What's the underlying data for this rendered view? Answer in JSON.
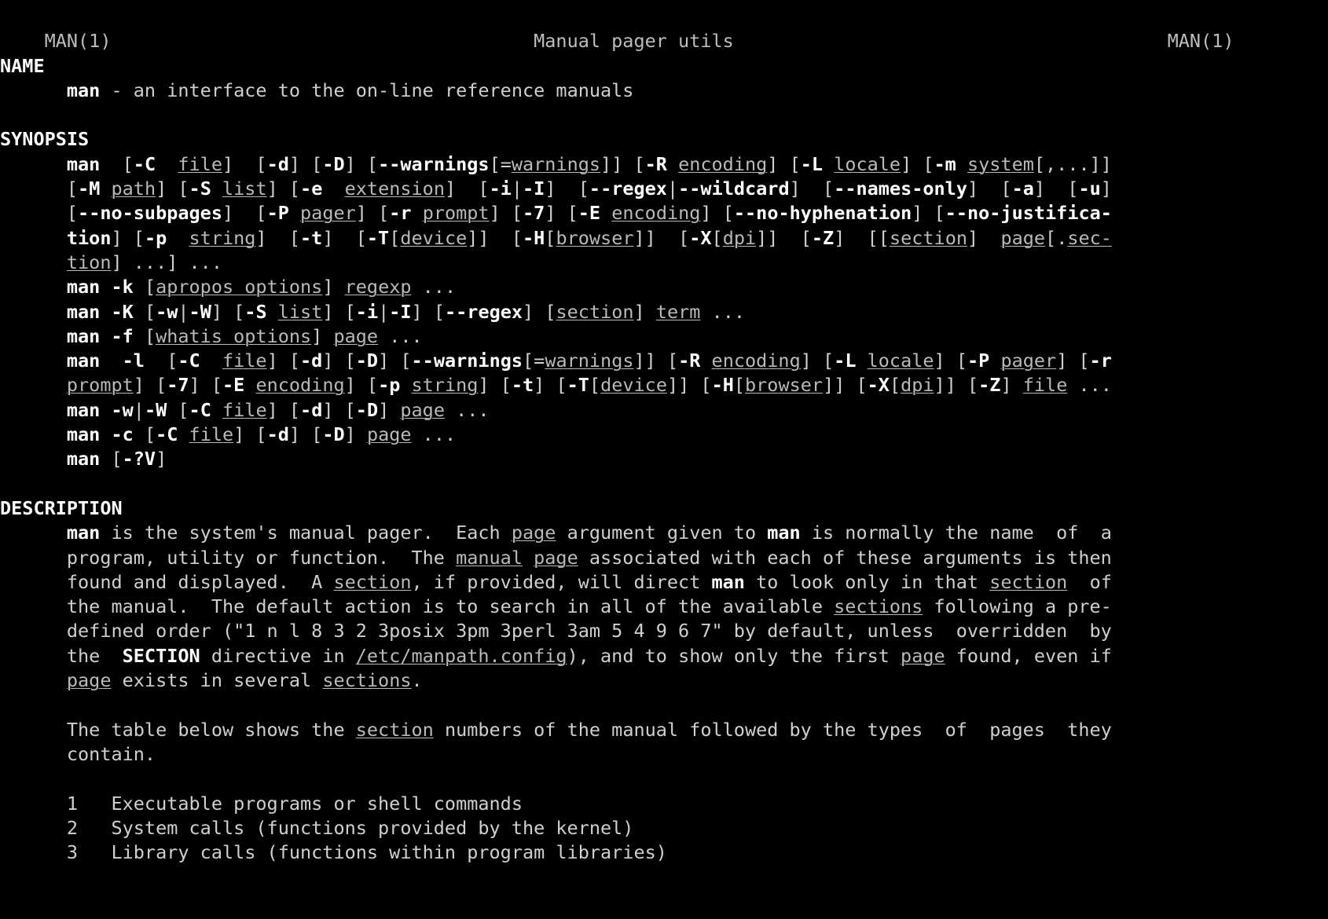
{
  "terminal": {
    "background": "#000000",
    "foreground": "#cfcfcf",
    "bold_color": "#ffffff",
    "italic_color": "#b9b9b9",
    "cols": 107,
    "rows": 37
  },
  "header": {
    "left": "MAN(1)",
    "center": "Manual pager utils",
    "right": "MAN(1)"
  },
  "sections": {
    "name": "NAME",
    "synopsis": "SYNOPSIS",
    "description": "DESCRIPTION"
  },
  "name_body": {
    "command": "man",
    "text": " - an interface to the on-line reference manuals"
  },
  "synopsis_lines": [
    [
      {
        "t": "      ",
        "s": "n"
      },
      {
        "t": "man",
        "s": "b"
      },
      {
        "t": "  [",
        "s": "n"
      },
      {
        "t": "-C",
        "s": "b"
      },
      {
        "t": "  ",
        "s": "n"
      },
      {
        "t": "file",
        "s": "i"
      },
      {
        "t": "]  [",
        "s": "n"
      },
      {
        "t": "-d",
        "s": "b"
      },
      {
        "t": "] [",
        "s": "n"
      },
      {
        "t": "-D",
        "s": "b"
      },
      {
        "t": "] [",
        "s": "n"
      },
      {
        "t": "--warnings",
        "s": "b"
      },
      {
        "t": "[=",
        "s": "n"
      },
      {
        "t": "warnings",
        "s": "i"
      },
      {
        "t": "]] [",
        "s": "n"
      },
      {
        "t": "-R",
        "s": "b"
      },
      {
        "t": " ",
        "s": "n"
      },
      {
        "t": "encoding",
        "s": "i"
      },
      {
        "t": "] [",
        "s": "n"
      },
      {
        "t": "-L",
        "s": "b"
      },
      {
        "t": " ",
        "s": "n"
      },
      {
        "t": "locale",
        "s": "i"
      },
      {
        "t": "] [",
        "s": "n"
      },
      {
        "t": "-m",
        "s": "b"
      },
      {
        "t": " ",
        "s": "n"
      },
      {
        "t": "system",
        "s": "i"
      },
      {
        "t": "[,...]]",
        "s": "n"
      }
    ],
    [
      {
        "t": "      [",
        "s": "n"
      },
      {
        "t": "-M",
        "s": "b"
      },
      {
        "t": " ",
        "s": "n"
      },
      {
        "t": "path",
        "s": "i"
      },
      {
        "t": "] [",
        "s": "n"
      },
      {
        "t": "-S",
        "s": "b"
      },
      {
        "t": " ",
        "s": "n"
      },
      {
        "t": "list",
        "s": "i"
      },
      {
        "t": "] [",
        "s": "n"
      },
      {
        "t": "-e",
        "s": "b"
      },
      {
        "t": "  ",
        "s": "n"
      },
      {
        "t": "extension",
        "s": "i"
      },
      {
        "t": "]  [",
        "s": "n"
      },
      {
        "t": "-i",
        "s": "b"
      },
      {
        "t": "|",
        "s": "n"
      },
      {
        "t": "-I",
        "s": "b"
      },
      {
        "t": "]  [",
        "s": "n"
      },
      {
        "t": "--regex",
        "s": "b"
      },
      {
        "t": "|",
        "s": "n"
      },
      {
        "t": "--wildcard",
        "s": "b"
      },
      {
        "t": "]  [",
        "s": "n"
      },
      {
        "t": "--names-only",
        "s": "b"
      },
      {
        "t": "]  [",
        "s": "n"
      },
      {
        "t": "-a",
        "s": "b"
      },
      {
        "t": "]  [",
        "s": "n"
      },
      {
        "t": "-u",
        "s": "b"
      },
      {
        "t": "]",
        "s": "n"
      }
    ],
    [
      {
        "t": "      [",
        "s": "n"
      },
      {
        "t": "--no-subpages",
        "s": "b"
      },
      {
        "t": "]  [",
        "s": "n"
      },
      {
        "t": "-P",
        "s": "b"
      },
      {
        "t": " ",
        "s": "n"
      },
      {
        "t": "pager",
        "s": "i"
      },
      {
        "t": "] [",
        "s": "n"
      },
      {
        "t": "-r",
        "s": "b"
      },
      {
        "t": " ",
        "s": "n"
      },
      {
        "t": "prompt",
        "s": "i"
      },
      {
        "t": "] [",
        "s": "n"
      },
      {
        "t": "-7",
        "s": "b"
      },
      {
        "t": "] [",
        "s": "n"
      },
      {
        "t": "-E",
        "s": "b"
      },
      {
        "t": " ",
        "s": "n"
      },
      {
        "t": "encoding",
        "s": "i"
      },
      {
        "t": "] [",
        "s": "n"
      },
      {
        "t": "--no-hyphenation",
        "s": "b"
      },
      {
        "t": "] [",
        "s": "n"
      },
      {
        "t": "--no-justifica-",
        "s": "b"
      }
    ],
    [
      {
        "t": "      ",
        "s": "n"
      },
      {
        "t": "tion",
        "s": "b"
      },
      {
        "t": "] [",
        "s": "n"
      },
      {
        "t": "-p",
        "s": "b"
      },
      {
        "t": "  ",
        "s": "n"
      },
      {
        "t": "string",
        "s": "i"
      },
      {
        "t": "]  [",
        "s": "n"
      },
      {
        "t": "-t",
        "s": "b"
      },
      {
        "t": "]  [",
        "s": "n"
      },
      {
        "t": "-T",
        "s": "b"
      },
      {
        "t": "[",
        "s": "n"
      },
      {
        "t": "device",
        "s": "i"
      },
      {
        "t": "]]  [",
        "s": "n"
      },
      {
        "t": "-H",
        "s": "b"
      },
      {
        "t": "[",
        "s": "n"
      },
      {
        "t": "browser",
        "s": "i"
      },
      {
        "t": "]]  [",
        "s": "n"
      },
      {
        "t": "-X",
        "s": "b"
      },
      {
        "t": "[",
        "s": "n"
      },
      {
        "t": "dpi",
        "s": "i"
      },
      {
        "t": "]]  [",
        "s": "n"
      },
      {
        "t": "-Z",
        "s": "b"
      },
      {
        "t": "]  [[",
        "s": "n"
      },
      {
        "t": "section",
        "s": "i"
      },
      {
        "t": "]  ",
        "s": "n"
      },
      {
        "t": "page",
        "s": "i"
      },
      {
        "t": "[.",
        "s": "n"
      },
      {
        "t": "sec-",
        "s": "i"
      }
    ],
    [
      {
        "t": "      ",
        "s": "n"
      },
      {
        "t": "tion",
        "s": "i"
      },
      {
        "t": "] ...] ...",
        "s": "n"
      }
    ],
    [
      {
        "t": "      ",
        "s": "n"
      },
      {
        "t": "man",
        "s": "b"
      },
      {
        "t": " ",
        "s": "n"
      },
      {
        "t": "-k",
        "s": "b"
      },
      {
        "t": " [",
        "s": "n"
      },
      {
        "t": "apropos options",
        "s": "i"
      },
      {
        "t": "] ",
        "s": "n"
      },
      {
        "t": "regexp",
        "s": "i"
      },
      {
        "t": " ...",
        "s": "n"
      }
    ],
    [
      {
        "t": "      ",
        "s": "n"
      },
      {
        "t": "man",
        "s": "b"
      },
      {
        "t": " ",
        "s": "n"
      },
      {
        "t": "-K",
        "s": "b"
      },
      {
        "t": " [",
        "s": "n"
      },
      {
        "t": "-w",
        "s": "b"
      },
      {
        "t": "|",
        "s": "n"
      },
      {
        "t": "-W",
        "s": "b"
      },
      {
        "t": "] [",
        "s": "n"
      },
      {
        "t": "-S",
        "s": "b"
      },
      {
        "t": " ",
        "s": "n"
      },
      {
        "t": "list",
        "s": "i"
      },
      {
        "t": "] [",
        "s": "n"
      },
      {
        "t": "-i",
        "s": "b"
      },
      {
        "t": "|",
        "s": "n"
      },
      {
        "t": "-I",
        "s": "b"
      },
      {
        "t": "] [",
        "s": "n"
      },
      {
        "t": "--regex",
        "s": "b"
      },
      {
        "t": "] [",
        "s": "n"
      },
      {
        "t": "section",
        "s": "i"
      },
      {
        "t": "] ",
        "s": "n"
      },
      {
        "t": "term",
        "s": "i"
      },
      {
        "t": " ...",
        "s": "n"
      }
    ],
    [
      {
        "t": "      ",
        "s": "n"
      },
      {
        "t": "man",
        "s": "b"
      },
      {
        "t": " ",
        "s": "n"
      },
      {
        "t": "-f",
        "s": "b"
      },
      {
        "t": " [",
        "s": "n"
      },
      {
        "t": "whatis options",
        "s": "i"
      },
      {
        "t": "] ",
        "s": "n"
      },
      {
        "t": "page",
        "s": "i"
      },
      {
        "t": " ...",
        "s": "n"
      }
    ],
    [
      {
        "t": "      ",
        "s": "n"
      },
      {
        "t": "man",
        "s": "b"
      },
      {
        "t": "  ",
        "s": "n"
      },
      {
        "t": "-l",
        "s": "b"
      },
      {
        "t": "  [",
        "s": "n"
      },
      {
        "t": "-C",
        "s": "b"
      },
      {
        "t": "  ",
        "s": "n"
      },
      {
        "t": "file",
        "s": "i"
      },
      {
        "t": "] [",
        "s": "n"
      },
      {
        "t": "-d",
        "s": "b"
      },
      {
        "t": "] [",
        "s": "n"
      },
      {
        "t": "-D",
        "s": "b"
      },
      {
        "t": "] [",
        "s": "n"
      },
      {
        "t": "--warnings",
        "s": "b"
      },
      {
        "t": "[=",
        "s": "n"
      },
      {
        "t": "warnings",
        "s": "i"
      },
      {
        "t": "]] [",
        "s": "n"
      },
      {
        "t": "-R",
        "s": "b"
      },
      {
        "t": " ",
        "s": "n"
      },
      {
        "t": "encoding",
        "s": "i"
      },
      {
        "t": "] [",
        "s": "n"
      },
      {
        "t": "-L",
        "s": "b"
      },
      {
        "t": " ",
        "s": "n"
      },
      {
        "t": "locale",
        "s": "i"
      },
      {
        "t": "] [",
        "s": "n"
      },
      {
        "t": "-P",
        "s": "b"
      },
      {
        "t": " ",
        "s": "n"
      },
      {
        "t": "pager",
        "s": "i"
      },
      {
        "t": "] [",
        "s": "n"
      },
      {
        "t": "-r",
        "s": "b"
      }
    ],
    [
      {
        "t": "      ",
        "s": "n"
      },
      {
        "t": "prompt",
        "s": "i"
      },
      {
        "t": "] [",
        "s": "n"
      },
      {
        "t": "-7",
        "s": "b"
      },
      {
        "t": "] [",
        "s": "n"
      },
      {
        "t": "-E",
        "s": "b"
      },
      {
        "t": " ",
        "s": "n"
      },
      {
        "t": "encoding",
        "s": "i"
      },
      {
        "t": "] [",
        "s": "n"
      },
      {
        "t": "-p",
        "s": "b"
      },
      {
        "t": " ",
        "s": "n"
      },
      {
        "t": "string",
        "s": "i"
      },
      {
        "t": "] [",
        "s": "n"
      },
      {
        "t": "-t",
        "s": "b"
      },
      {
        "t": "] [",
        "s": "n"
      },
      {
        "t": "-T",
        "s": "b"
      },
      {
        "t": "[",
        "s": "n"
      },
      {
        "t": "device",
        "s": "i"
      },
      {
        "t": "]] [",
        "s": "n"
      },
      {
        "t": "-H",
        "s": "b"
      },
      {
        "t": "[",
        "s": "n"
      },
      {
        "t": "browser",
        "s": "i"
      },
      {
        "t": "]] [",
        "s": "n"
      },
      {
        "t": "-X",
        "s": "b"
      },
      {
        "t": "[",
        "s": "n"
      },
      {
        "t": "dpi",
        "s": "i"
      },
      {
        "t": "]] [",
        "s": "n"
      },
      {
        "t": "-Z",
        "s": "b"
      },
      {
        "t": "] ",
        "s": "n"
      },
      {
        "t": "file",
        "s": "i"
      },
      {
        "t": " ...",
        "s": "n"
      }
    ],
    [
      {
        "t": "      ",
        "s": "n"
      },
      {
        "t": "man",
        "s": "b"
      },
      {
        "t": " ",
        "s": "n"
      },
      {
        "t": "-w",
        "s": "b"
      },
      {
        "t": "|",
        "s": "n"
      },
      {
        "t": "-W",
        "s": "b"
      },
      {
        "t": " [",
        "s": "n"
      },
      {
        "t": "-C",
        "s": "b"
      },
      {
        "t": " ",
        "s": "n"
      },
      {
        "t": "file",
        "s": "i"
      },
      {
        "t": "] [",
        "s": "n"
      },
      {
        "t": "-d",
        "s": "b"
      },
      {
        "t": "] [",
        "s": "n"
      },
      {
        "t": "-D",
        "s": "b"
      },
      {
        "t": "] ",
        "s": "n"
      },
      {
        "t": "page",
        "s": "i"
      },
      {
        "t": " ...",
        "s": "n"
      }
    ],
    [
      {
        "t": "      ",
        "s": "n"
      },
      {
        "t": "man",
        "s": "b"
      },
      {
        "t": " ",
        "s": "n"
      },
      {
        "t": "-c",
        "s": "b"
      },
      {
        "t": " [",
        "s": "n"
      },
      {
        "t": "-C",
        "s": "b"
      },
      {
        "t": " ",
        "s": "n"
      },
      {
        "t": "file",
        "s": "i"
      },
      {
        "t": "] [",
        "s": "n"
      },
      {
        "t": "-d",
        "s": "b"
      },
      {
        "t": "] [",
        "s": "n"
      },
      {
        "t": "-D",
        "s": "b"
      },
      {
        "t": "] ",
        "s": "n"
      },
      {
        "t": "page",
        "s": "i"
      },
      {
        "t": " ...",
        "s": "n"
      }
    ],
    [
      {
        "t": "      ",
        "s": "n"
      },
      {
        "t": "man",
        "s": "b"
      },
      {
        "t": " [",
        "s": "n"
      },
      {
        "t": "-?V",
        "s": "b"
      },
      {
        "t": "]",
        "s": "n"
      }
    ]
  ],
  "description_lines": [
    [
      {
        "t": "      ",
        "s": "n"
      },
      {
        "t": "man",
        "s": "b"
      },
      {
        "t": " is the system's manual pager.  Each ",
        "s": "n"
      },
      {
        "t": "page",
        "s": "i"
      },
      {
        "t": " argument given to ",
        "s": "n"
      },
      {
        "t": "man",
        "s": "b"
      },
      {
        "t": " is normally the name  of  a",
        "s": "n"
      }
    ],
    [
      {
        "t": "      program, utility or function.  The ",
        "s": "n"
      },
      {
        "t": "manual",
        "s": "i"
      },
      {
        "t": " ",
        "s": "n"
      },
      {
        "t": "page",
        "s": "i"
      },
      {
        "t": " associated with each of these arguments is then",
        "s": "n"
      }
    ],
    [
      {
        "t": "      found and displayed.  A ",
        "s": "n"
      },
      {
        "t": "section",
        "s": "i"
      },
      {
        "t": ", if provided, will direct ",
        "s": "n"
      },
      {
        "t": "man",
        "s": "b"
      },
      {
        "t": " to look only in that ",
        "s": "n"
      },
      {
        "t": "section",
        "s": "i"
      },
      {
        "t": "  of",
        "s": "n"
      }
    ],
    [
      {
        "t": "      the manual.  The default action is to search in all of the available ",
        "s": "n"
      },
      {
        "t": "sections",
        "s": "i"
      },
      {
        "t": " following a pre-",
        "s": "n"
      }
    ],
    [
      {
        "t": "      defined order (\"1 n l 8 3 2 3posix 3pm 3perl 3am 5 4 9 6 7\" by default, unless  overridden  by",
        "s": "n"
      }
    ],
    [
      {
        "t": "      the  ",
        "s": "n"
      },
      {
        "t": "SECTION",
        "s": "b"
      },
      {
        "t": " directive in ",
        "s": "n"
      },
      {
        "t": "/etc/manpath.config",
        "s": "i"
      },
      {
        "t": "), and to show only the first ",
        "s": "n"
      },
      {
        "t": "page",
        "s": "i"
      },
      {
        "t": " found, even if",
        "s": "n"
      }
    ],
    [
      {
        "t": "      ",
        "s": "n"
      },
      {
        "t": "page",
        "s": "i"
      },
      {
        "t": " exists in several ",
        "s": "n"
      },
      {
        "t": "sections",
        "s": "i"
      },
      {
        "t": ".",
        "s": "n"
      }
    ],
    [],
    [
      {
        "t": "      The table below shows the ",
        "s": "n"
      },
      {
        "t": "section",
        "s": "i"
      },
      {
        "t": " numbers of the manual followed by the types  of  pages  they",
        "s": "n"
      }
    ],
    [
      {
        "t": "      contain.",
        "s": "n"
      }
    ],
    [],
    [
      {
        "t": "      1   Executable programs or shell commands",
        "s": "n"
      }
    ],
    [
      {
        "t": "      2   System calls (functions provided by the kernel)",
        "s": "n"
      }
    ],
    [
      {
        "t": "      3   Library calls (functions within program libraries)",
        "s": "n"
      }
    ]
  ],
  "section_table": [
    {
      "number": "1",
      "desc": "Executable programs or shell commands"
    },
    {
      "number": "2",
      "desc": "System calls (functions provided by the kernel)"
    },
    {
      "number": "3",
      "desc": "Library calls (functions within program libraries)"
    }
  ]
}
